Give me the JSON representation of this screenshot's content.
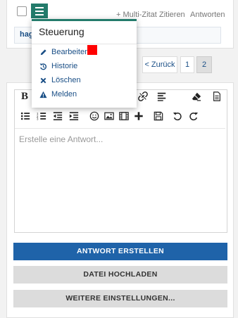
{
  "post": {
    "actions": {
      "multi_quote": "+ Multi-Zitat",
      "quote": "Zitieren",
      "reply": "Antworten"
    },
    "author": "hag"
  },
  "pagination": {
    "prev": "< Zurück",
    "pages": [
      "1",
      "2"
    ],
    "current": "2"
  },
  "editor": {
    "toolbar_row1": [
      {
        "icon": "bold-icon",
        "label": "B"
      },
      {
        "icon": "italic-icon",
        "label": "I"
      },
      {
        "icon": "underline-icon",
        "label": "U"
      },
      {
        "icon": "strikethrough-icon",
        "label": "S"
      },
      {
        "icon": "text-size-icon",
        "label": "T"
      },
      {
        "icon": "font-icon",
        "label": "A"
      },
      {
        "icon": "link-icon"
      },
      {
        "icon": "align-icon"
      },
      {
        "icon": "eraser-icon"
      },
      {
        "icon": "source-icon"
      }
    ],
    "toolbar_row2": [
      "bullet-list-icon",
      "numbered-list-icon",
      "outdent-icon",
      "indent-icon",
      "smiley-icon",
      "image-icon",
      "media-icon",
      "insert-icon",
      "save-icon",
      "undo-icon",
      "redo-icon"
    ],
    "placeholder": "Erstelle eine Antwort..."
  },
  "buttons": {
    "submit": "ANTWORT ERSTELLEN",
    "upload": "DATEI HOCHLADEN",
    "more": "WEITERE EINSTELLUNGEN..."
  },
  "menu": {
    "title": "Steuerung",
    "items": [
      {
        "label": "Bearbeiten",
        "icon": "pencil-icon"
      },
      {
        "label": "Historie",
        "icon": "history-icon"
      },
      {
        "label": "Löschen",
        "icon": "delete-icon"
      },
      {
        "label": "Melden",
        "icon": "warning-icon"
      }
    ]
  },
  "colors": {
    "accent": "#237b6b",
    "primary": "#1f63a9",
    "link": "#1a4f86",
    "marker": "#ff0000"
  }
}
